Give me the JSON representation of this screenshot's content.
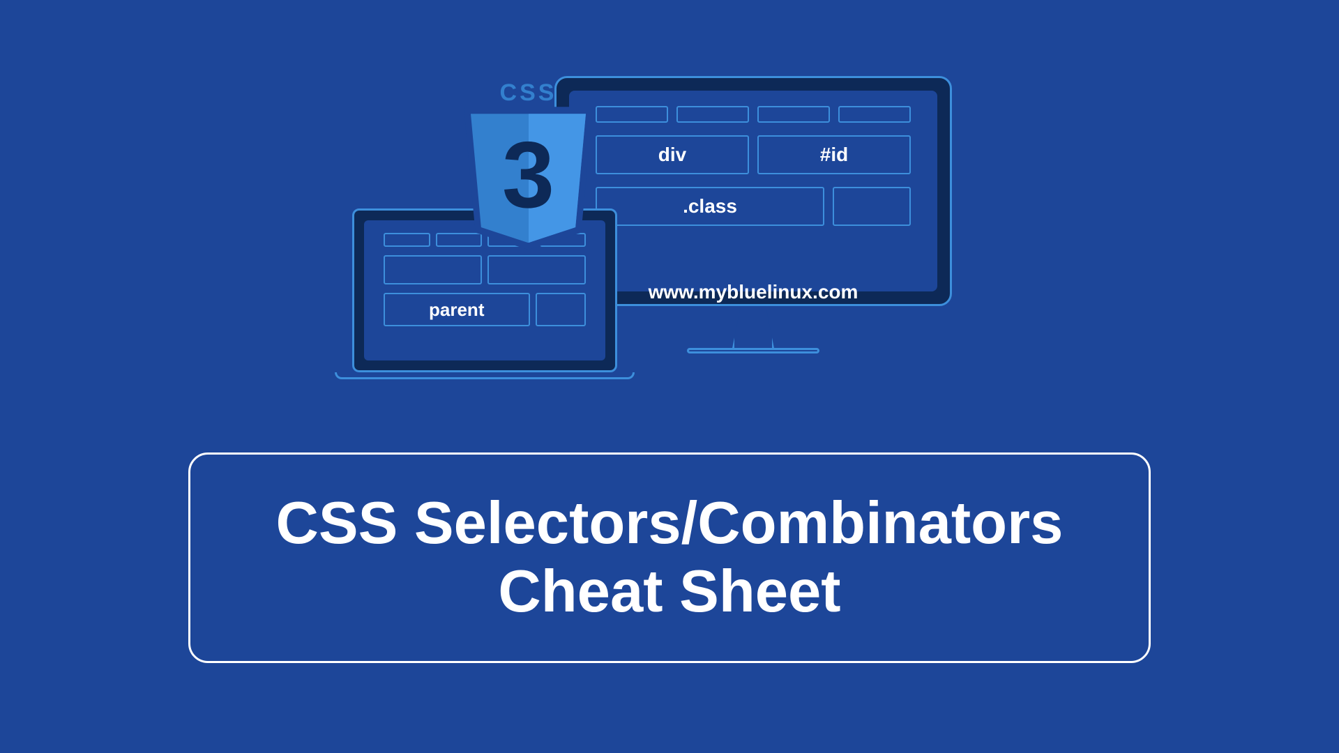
{
  "badge": {
    "label": "CSS",
    "version": "3"
  },
  "monitor": {
    "box_div": "div",
    "box_id": "#id",
    "box_class": ".class"
  },
  "laptop": {
    "box_parent": "parent"
  },
  "url": "www.mybluelinux.com",
  "title": "CSS Selectors/Combinators Cheat Sheet"
}
